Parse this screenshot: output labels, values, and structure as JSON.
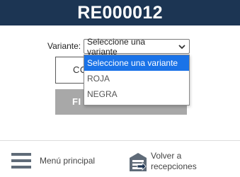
{
  "header": {
    "title": "RE000012"
  },
  "variant": {
    "label": "Variante:",
    "selected": "Seleccione una variante",
    "options": [
      "Seleccione una variante",
      "ROJA",
      "NEGRA"
    ]
  },
  "buttons": {
    "co_label": "CO",
    "fi_label": "FI"
  },
  "footer": {
    "menu_label": "Menú principal",
    "back_label": "Volver a recepciones"
  },
  "colors": {
    "header_bg": "#1c3553",
    "selected_option": "#1a73e8",
    "disabled_button": "#a8a8a8"
  }
}
